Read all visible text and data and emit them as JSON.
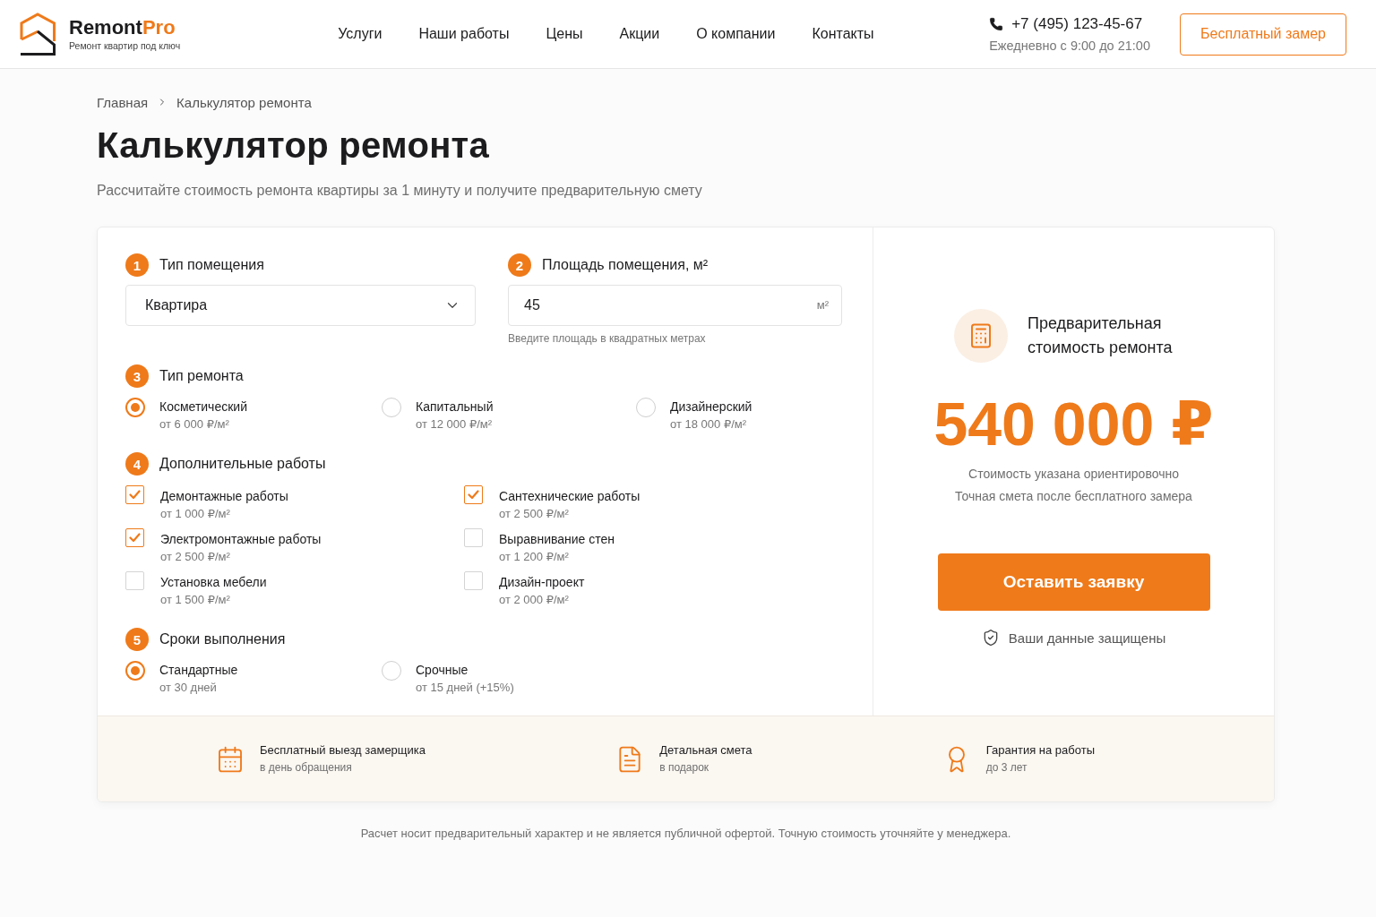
{
  "header": {
    "logo": {
      "name": "Remont",
      "accent": "Pro",
      "tagline": "Ремонт квартир под ключ"
    },
    "nav": [
      {
        "label": "Услуги"
      },
      {
        "label": "Наши работы"
      },
      {
        "label": "Цены"
      },
      {
        "label": "Акции"
      },
      {
        "label": "О компании"
      },
      {
        "label": "Контакты"
      }
    ],
    "contact": {
      "phone": "+7 (495) 123-45-67",
      "hours": "Ежедневно с 9:00 до 21:00"
    },
    "cta": "Бесплатный замер"
  },
  "breadcrumbs": [
    {
      "label": "Главная"
    },
    {
      "label": "Калькулятор ремонта"
    }
  ],
  "title": "Калькулятор ремонта",
  "subtitle": "Рассчитайте стоимость ремонта квартиры за 1 минуту и получите предварительную смету",
  "calculator": {
    "sections": [
      {
        "kind": "select",
        "number": "1",
        "title": "Тип помещения",
        "value": "Квартира"
      },
      {
        "kind": "number",
        "number": "2",
        "title": "Площадь помещения, м²",
        "value": "45",
        "unit": "м²",
        "helper_text": "Введите площадь в квадратных метрах"
      },
      {
        "kind": "radio",
        "number": "3",
        "title": "Тип ремонта",
        "options": [
          {
            "label": "Косметический",
            "detail": "от 6 000 ₽/м²",
            "selected": true
          },
          {
            "label": "Капитальный",
            "detail": "от 12 000 ₽/м²",
            "selected": false
          },
          {
            "label": "Дизайнерский",
            "detail": "от 18 000 ₽/м²",
            "selected": false
          }
        ]
      },
      {
        "kind": "checkbox",
        "number": "4",
        "title": "Дополнительные работы",
        "options": [
          {
            "label": "Демонтажные работы",
            "detail": "от 1 000 ₽/м²",
            "checked": true
          },
          {
            "label": "Сантехнические работы",
            "detail": "от 2 500 ₽/м²",
            "checked": true
          },
          {
            "label": "Электромонтажные работы",
            "detail": "от 2 500 ₽/м²",
            "checked": true
          },
          {
            "label": "Выравнивание стен",
            "detail": "от 1 200 ₽/м²",
            "checked": false
          },
          {
            "label": "Установка мебели",
            "detail": "от 1 500 ₽/м²",
            "checked": false
          },
          {
            "label": "Дизайн-проект",
            "detail": "от 2 000 ₽/м²",
            "checked": false
          }
        ]
      },
      {
        "kind": "radio",
        "number": "5",
        "title": "Сроки выполнения",
        "options": [
          {
            "label": "Стандартные",
            "detail": "от 30 дней",
            "selected": true
          },
          {
            "label": "Срочные",
            "detail": "от 15 дней (+15%)",
            "selected": false
          }
        ]
      }
    ]
  },
  "result": {
    "title": "Предварительная стоимость ремонта",
    "price": "540 000 ₽",
    "notes": [
      "Стоимость указана ориентировочно",
      "Точная смета после бесплатного замера"
    ],
    "button": "Оставить заявку",
    "secure_note": "Ваши данные защищены"
  },
  "features": [
    {
      "kind": "calendar",
      "title": "Бесплатный выезд замерщика",
      "subtitle": "в день обращения"
    },
    {
      "kind": "document",
      "title": "Детальная смета",
      "subtitle": "в подарок"
    },
    {
      "kind": "guarantee",
      "title": "Гарантия на работы",
      "subtitle": "до 3 лет"
    }
  ],
  "disclaimer": "Расчет носит предварительный характер и не является публичной офертой. Точную стоимость уточняйте у менеджера."
}
